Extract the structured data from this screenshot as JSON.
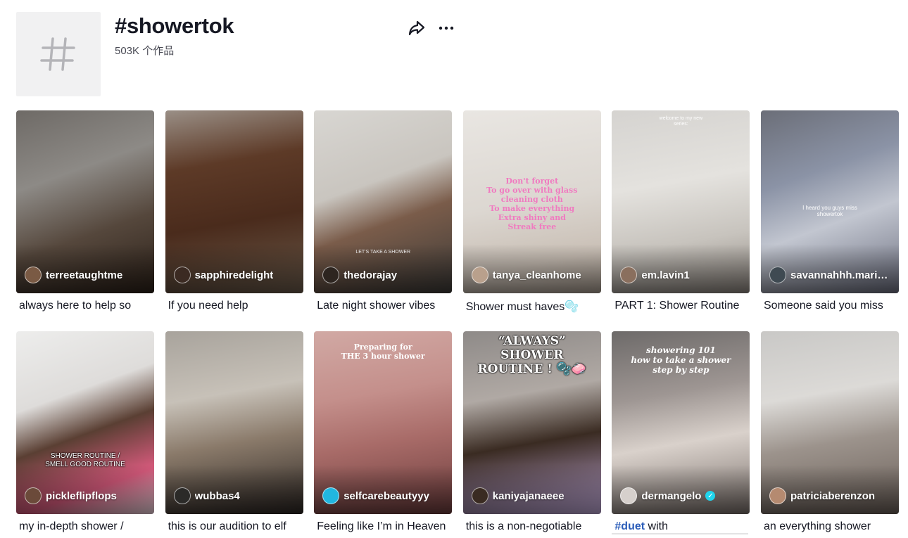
{
  "header": {
    "title": "#showertok",
    "count": "503K 个作品"
  },
  "icons": {
    "hashtag": "hashtag-icon",
    "share": "share-icon",
    "more": "more-icon"
  },
  "videos": [
    {
      "author": "terreetaughtme",
      "caption": "always here to help so",
      "bg": "linear-gradient(160deg,#6e6a66 0%,#8d8a86 35%,#55473c 65%,#2c2119 100%)",
      "avatar": "#7a5a44",
      "overlay": ""
    },
    {
      "author": "sapphiredelight",
      "caption": "If you need help",
      "bg": "linear-gradient(170deg,#9a8f86 0%,#5d3a27 30%,#4a2b1c 60%,#6a5a4a 100%)",
      "avatar": "#3b2a22",
      "overlay": ""
    },
    {
      "author": "thedorajay",
      "caption": "Late night shower vibes",
      "bg": "linear-gradient(160deg,#d8d6d2 0%,#c9c5bf 40%,#7a5c4a 60%,#3d3b38 100%)",
      "avatar": "#2d2520",
      "overlay": "LET'S TAKE A SHOWER"
    },
    {
      "author": "tanya_cleanhome",
      "caption": "Shower must haves🫧",
      "bg": "linear-gradient(170deg,#e9e6e2 0%,#dcd7d1 50%,#c9bfb5 80%,#a89c90 100%)",
      "avatar": "#b9a08c",
      "overlay": "Don't forget\nTo go over with glass\ncleaning cloth\nTo make everything\nExtra shiny and\nStreak free"
    },
    {
      "author": "em.lavin1",
      "caption": "PART 1: Shower Routine",
      "bg": "linear-gradient(170deg,#d5d3d0 0%,#e4e2de 40%,#c7c3bd 70%,#8e8780 100%)",
      "avatar": "#8a6f5e",
      "overlay": "welcome to my new\nseries:"
    },
    {
      "author": "savannahhh.mari…",
      "caption": "Someone said you miss",
      "bg": "linear-gradient(160deg,#6b6e78 0%,#8b93a6 35%,#c2c6d0 60%,#6d7080 100%)",
      "avatar": "#3f4a52",
      "overlay": "I heard you guys miss\nshowertok"
    },
    {
      "author": "pickleflipflops",
      "caption": "my in-depth shower /",
      "bg": "linear-gradient(160deg,#ededec 0%,#dedcda 35%,#5a3f33 55%,#d65a7c 80%,#f0d7e0 100%)",
      "avatar": "#6b4a3a",
      "overlay": "SHOWER ROUTINE /\nSMELL GOOD ROUTINE"
    },
    {
      "author": "wubbas4",
      "caption": "this is our audition to elf",
      "bg": "linear-gradient(170deg,#a8a39c 0%,#c7c1b8 35%,#8a7a6a 60%,#2c2623 100%)",
      "avatar": "#2b2a28",
      "overlay": ""
    },
    {
      "author": "selfcarebeautyyy",
      "caption": "Feeling like I’m in Heaven",
      "bg": "linear-gradient(170deg,#d1a9a4 0%,#c48f8b 35%,#a86b68 60%,#6b3c3c 100%)",
      "avatar": "#21b6e0",
      "overlay": "Preparing for\nTHE 3 hour shower"
    },
    {
      "author": "kaniyajanaeee",
      "caption": "this is a non-negotiable",
      "bg": "linear-gradient(170deg,#8e8a88 0%,#b0a9a4 35%,#3a2b22 60%,#c0a8d8 100%)",
      "avatar": "#3a2b22",
      "overlay": "“ALWAYS” SHOWER\nROUTINE ! 🫧🧼"
    },
    {
      "author": "dermangelo",
      "caption_hashtag": "#duet",
      "caption": " with",
      "verified": true,
      "bg": "linear-gradient(170deg,#6d6a69 0%,#9e9693 35%,#d9d1cb 60%,#7a706b 100%)",
      "avatar": "#d6d0cc",
      "overlay": "showering 101\nhow to take a shower\nstep by step"
    },
    {
      "author": "patriciaberenzon",
      "caption": "an everything shower",
      "bg": "linear-gradient(170deg,#c9c8c6 0%,#dcdad7 35%,#9c938c 60%,#6a5f58 100%)",
      "avatar": "#b58a70",
      "overlay": ""
    }
  ]
}
